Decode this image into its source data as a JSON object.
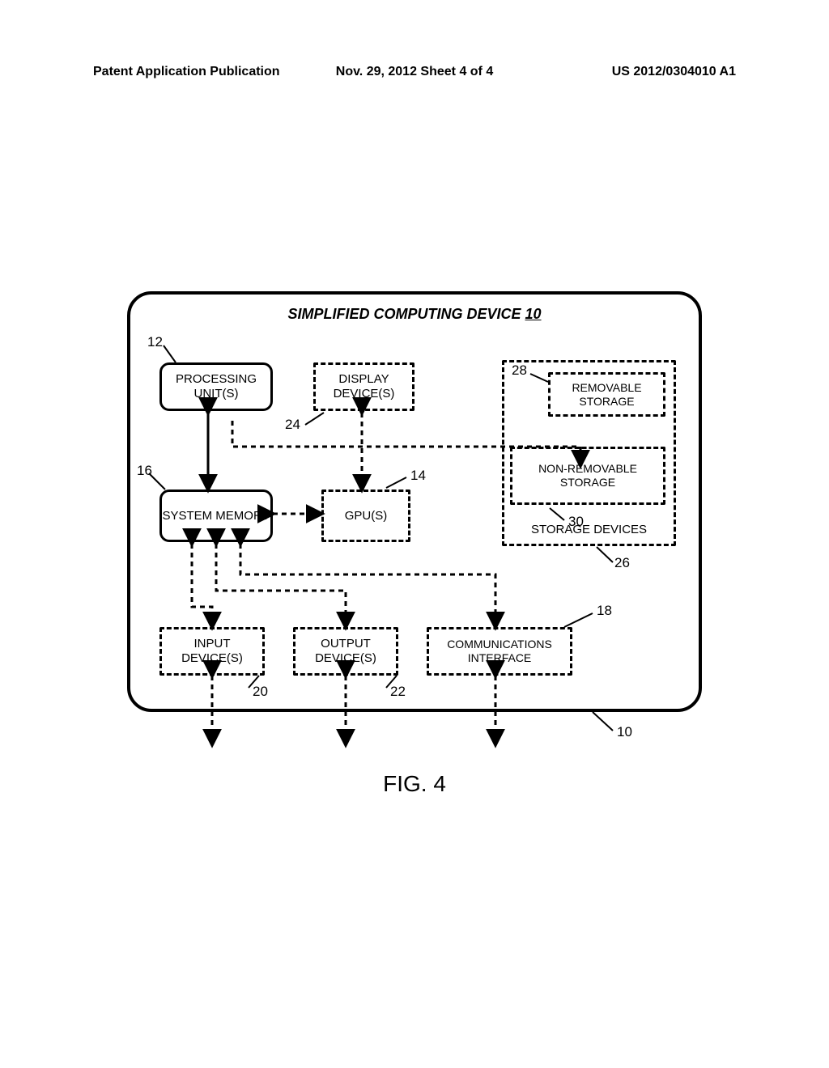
{
  "header": {
    "left": "Patent Application Publication",
    "center": "Nov. 29, 2012  Sheet 4 of 4",
    "right": "US 2012/0304010 A1"
  },
  "diagram": {
    "title_text": "SIMPLIFIED COMPUTING DEVICE ",
    "title_num": "10",
    "blocks": {
      "processing": "PROCESSING UNIT(S)",
      "display": "DISPLAY DEVICE(S)",
      "removable": "REMOVABLE STORAGE",
      "nonremovable": "NON-REMOVABLE STORAGE",
      "storage_devices": "STORAGE DEVICES",
      "system_memory": "SYSTEM MEMORY",
      "gpus": "GPU(S)",
      "input": "INPUT DEVICE(S)",
      "output": "OUTPUT DEVICE(S)",
      "comms": "COMMUNICATIONS INTERFACE"
    },
    "refs": {
      "r10": "10",
      "r12": "12",
      "r14": "14",
      "r16": "16",
      "r18": "18",
      "r20": "20",
      "r22": "22",
      "r24": "24",
      "r26": "26",
      "r28": "28",
      "r30": "30"
    }
  },
  "figure_caption": "FIG. 4"
}
